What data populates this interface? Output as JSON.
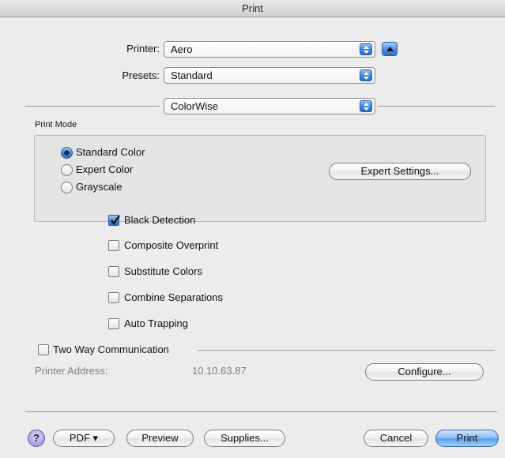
{
  "window": {
    "title": "Print"
  },
  "printer": {
    "label": "Printer:",
    "value": "Aero"
  },
  "presets": {
    "label": "Presets:",
    "value": "Standard"
  },
  "panel": {
    "value": "ColorWise"
  },
  "print_mode": {
    "title": "Print Mode",
    "options": [
      {
        "label": "Standard Color",
        "selected": true
      },
      {
        "label": "Expert Color",
        "selected": false
      },
      {
        "label": "Grayscale",
        "selected": false
      }
    ],
    "expert_button": "Expert Settings..."
  },
  "checkboxes": [
    {
      "label": "Black Detection",
      "checked": true
    },
    {
      "label": "Composite Overprint",
      "checked": false
    },
    {
      "label": "Substitute Colors",
      "checked": false
    },
    {
      "label": "Combine Separations",
      "checked": false
    },
    {
      "label": "Auto Trapping",
      "checked": false
    }
  ],
  "two_way": {
    "label": "Two Way Communication",
    "checked": false,
    "address_label": "Printer Address:",
    "address_value": "10.10.63.87",
    "configure_button": "Configure..."
  },
  "footer": {
    "help": "?",
    "pdf": "PDF ▾",
    "preview": "Preview",
    "supplies": "Supplies...",
    "cancel": "Cancel",
    "print": "Print"
  },
  "colors": {
    "accent": "#3b84da",
    "background": "#ececec"
  }
}
